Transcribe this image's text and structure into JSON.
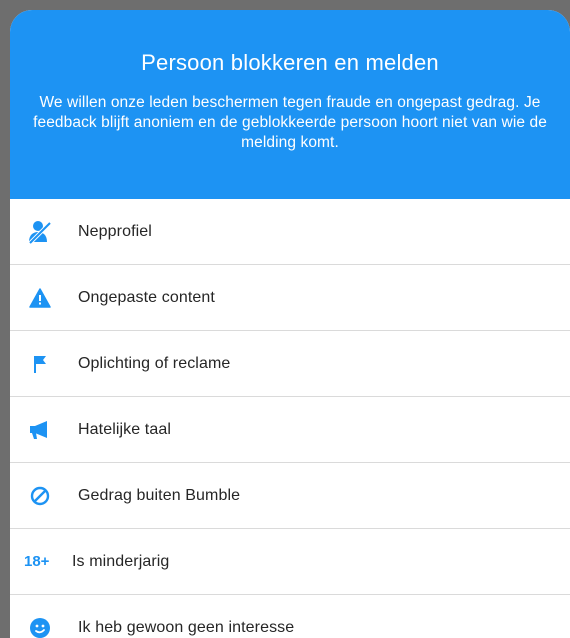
{
  "dialog": {
    "title": "Persoon blokkeren en melden",
    "description": "We willen onze leden beschermen tegen fraude en ongepast gedrag. Je feedback blijft anoniem en de geblokkeerde persoon hoort niet van wie de melding komt.",
    "accent_color": "#1d93f3"
  },
  "options": [
    {
      "icon": "fake-profile-icon",
      "label": "Nepprofiel"
    },
    {
      "icon": "warning-icon",
      "label": "Ongepaste content"
    },
    {
      "icon": "flag-icon",
      "label": "Oplichting of reclame"
    },
    {
      "icon": "megaphone-icon",
      "label": "Hatelijke taal"
    },
    {
      "icon": "prohibited-icon",
      "label": "Gedrag buiten Bumble"
    },
    {
      "icon": "age-18-plus-icon",
      "icon_text": "18+",
      "label": "Is minderjarig"
    },
    {
      "icon": "emoji-face-icon",
      "label": "Ik heb gewoon geen interesse"
    }
  ]
}
